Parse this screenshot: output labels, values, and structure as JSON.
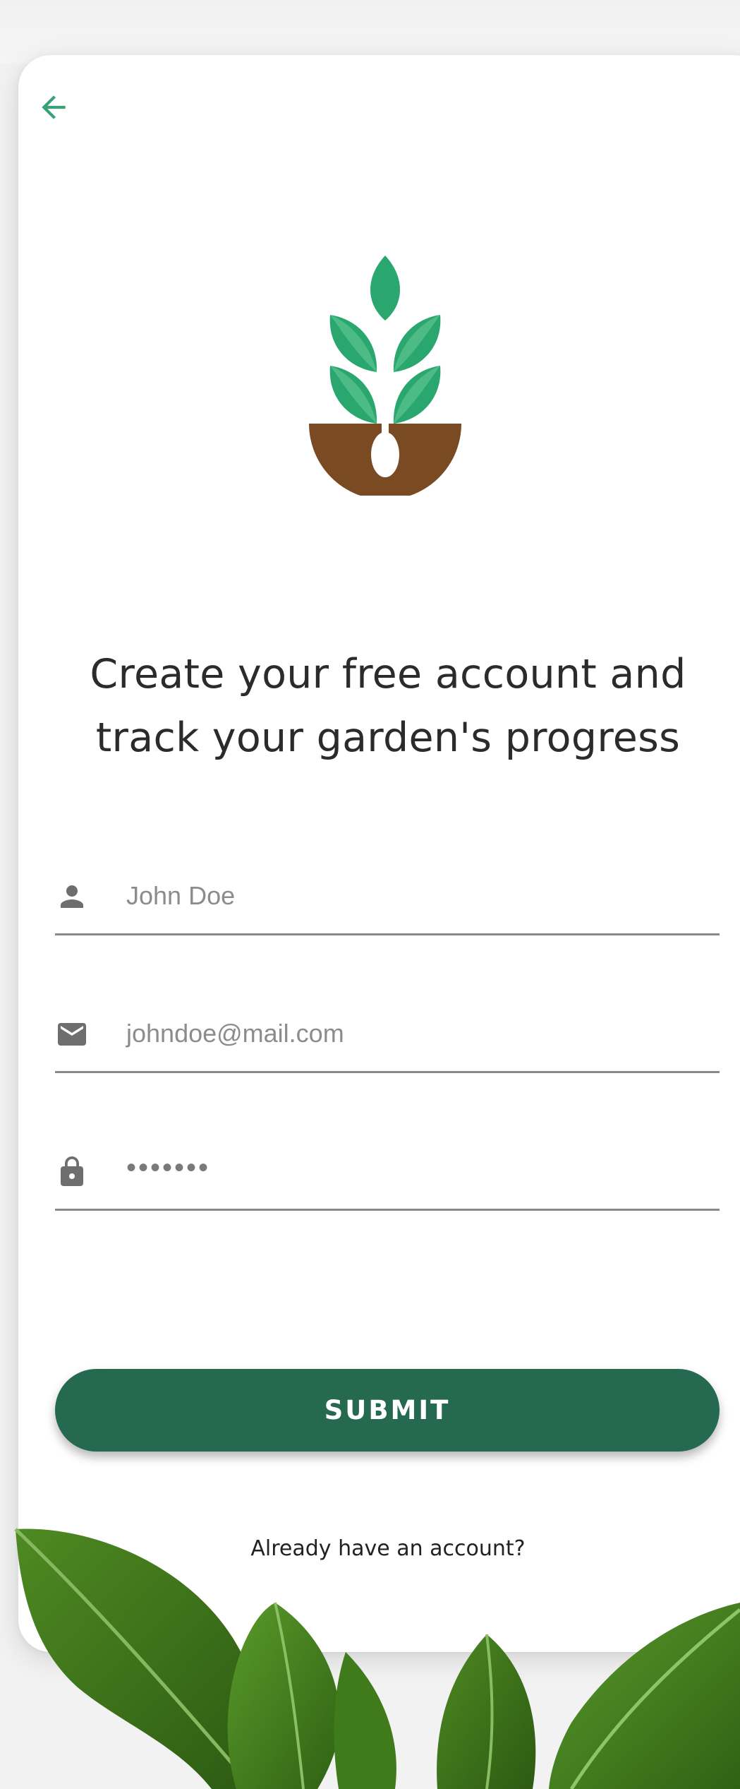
{
  "header": {
    "back_icon": "arrow-left-icon"
  },
  "logo": {
    "icon": "sprout-logo",
    "colors": {
      "leaf": "#2aa76e",
      "soil": "#7a4a23"
    }
  },
  "headline": {
    "line1": "Create your free account and",
    "line2": "track your garden's progress"
  },
  "form": {
    "name": {
      "icon": "person-icon",
      "value": "John Doe"
    },
    "email": {
      "icon": "mail-icon",
      "value": "johndoe@mail.com"
    },
    "password": {
      "icon": "lock-icon",
      "value": "•••••••"
    }
  },
  "submit": {
    "label": "SUBMIT"
  },
  "footer": {
    "signin_text": "Already have an account?"
  },
  "colors": {
    "accent": "#2aa76e",
    "button": "#256a50",
    "text": "#2b2b2b",
    "muted": "#8c8c8c"
  }
}
